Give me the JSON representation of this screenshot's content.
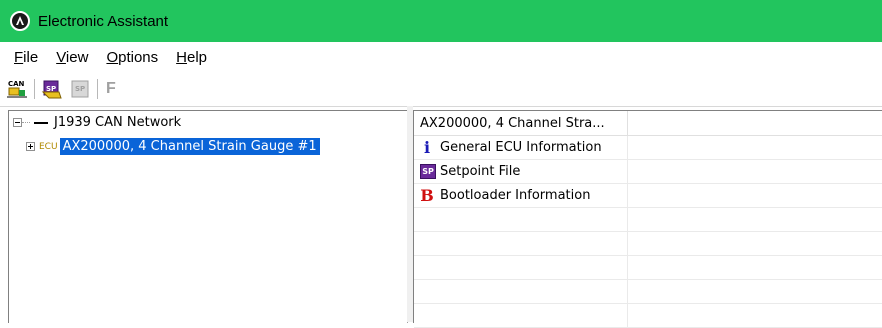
{
  "window": {
    "title": "Electronic Assistant"
  },
  "menu": [
    {
      "label_u": "F",
      "label_rest": "ile"
    },
    {
      "label_u": "V",
      "label_rest": "iew"
    },
    {
      "label_u": "O",
      "label_rest": "ptions"
    },
    {
      "label_u": "H",
      "label_rest": "elp"
    }
  ],
  "toolbar": {
    "can_icon_label": "CAN",
    "sp_label": "SP",
    "f_label": "F"
  },
  "tree": {
    "root_label": "J1939 CAN Network",
    "ecu_tag": "ECU",
    "child_label": "AX200000, 4 Channel Strain Gauge #1"
  },
  "list": {
    "column_header": "AX200000, 4 Channel Stra...",
    "items": [
      {
        "icon": "info-icon",
        "glyph": "i",
        "label": "General ECU Information"
      },
      {
        "icon": "setpoint-icon",
        "glyph": "SP",
        "label": "Setpoint File"
      },
      {
        "icon": "bootloader-icon",
        "glyph": "B",
        "label": "Bootloader Information"
      }
    ],
    "empty_rows": 6
  },
  "colors": {
    "titlebar": "#22c55e",
    "selection": "#0a64d8",
    "info": "#1a1ab5",
    "bootloader": "#d01010"
  }
}
